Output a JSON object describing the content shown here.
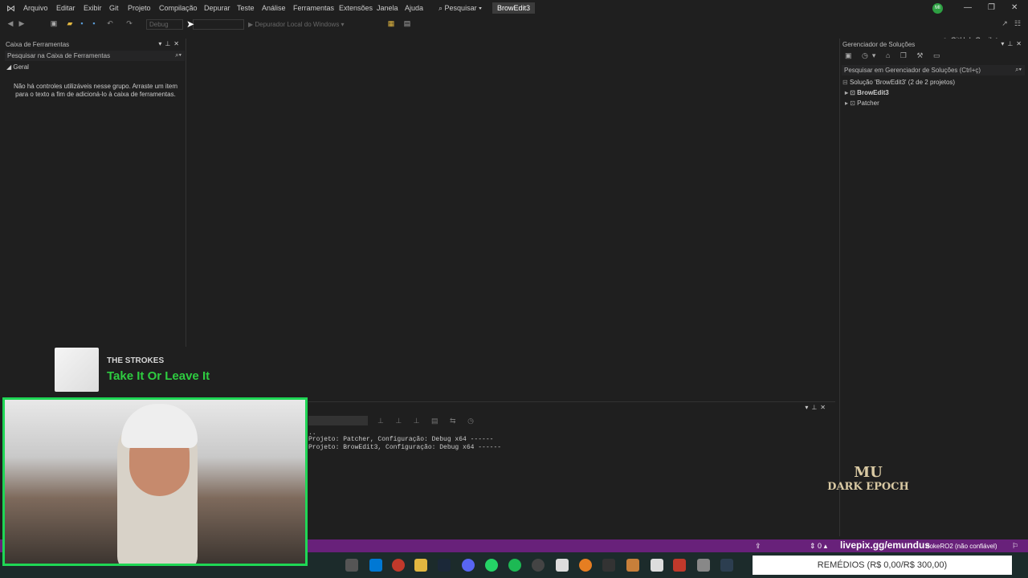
{
  "menu": {
    "items": [
      "Arquivo",
      "Editar",
      "Exibir",
      "Git",
      "Projeto",
      "Compilação",
      "Depurar",
      "Teste",
      "Análise",
      "Ferramentas",
      "Extensões",
      "Janela",
      "Ajuda"
    ],
    "search_label": "Pesquisar",
    "solution_title": "BrowEdit3",
    "avatar_initials": "MI"
  },
  "toolbar": {
    "config_value": "Debug",
    "debug_label": "Depurador Local do Windows",
    "copilot_label": "GitHub Copilot"
  },
  "toolbox": {
    "title": "Caixa de Ferramentas",
    "search_placeholder": "Pesquisar na Caixa de Ferramentas",
    "group": "Geral",
    "empty_message": "Não há controles utilizáveis nesse grupo. Arraste um item para o texto a fim de adicioná-lo à caixa de ferramentas."
  },
  "solution_explorer": {
    "title": "Gerenciador de Soluções",
    "search_placeholder": "Pesquisar em Gerenciador de Soluções (Ctrl+ç)",
    "solution_label": "Solução 'BrowEdit3' (2 de 2 projetos)",
    "projects": [
      "BrowEdit3",
      "Patcher"
    ]
  },
  "output": {
    "lines": [
      "..",
      "Projeto: Patcher, Configuração: Debug x64 ------",
      "Projeto: BrowEdit3, Configuração: Debug x64 ------"
    ]
  },
  "statusbar": {
    "count": "0",
    "repo": "nokeRO2 (não confiável)"
  },
  "overlays": {
    "now_playing_artist": "THE STROKES",
    "now_playing_title": "Take It Or Leave It",
    "livepix": "livepix.gg/emundus",
    "remedios": "REMÉDIOS (R$ 0,00/R$ 300,00)",
    "game_logo_line1": "MU",
    "game_logo_line2": "DARK EPOCH"
  }
}
